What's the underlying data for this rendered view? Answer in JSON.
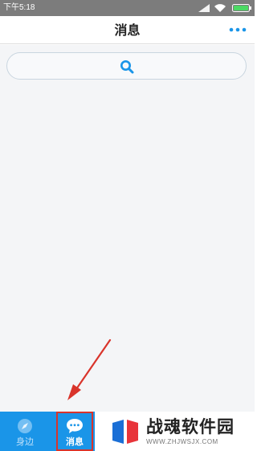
{
  "status_bar": {
    "time": "下午5:18",
    "icons": [
      "signal-icon",
      "wifi-icon",
      "battery-icon"
    ]
  },
  "header": {
    "title": "消息",
    "more_icon": "more-icon"
  },
  "search": {
    "icon": "search-icon",
    "placeholder": ""
  },
  "tab_bar": {
    "tabs": [
      {
        "label": "身边",
        "icon": "compass-icon",
        "selected": false
      },
      {
        "label": "消息",
        "icon": "chat-bubble-icon",
        "selected": true
      }
    ]
  },
  "watermark": {
    "title": "战魂软件园",
    "url": "WWW.ZHJWSJX.COM"
  },
  "colors": {
    "accent": "#1a95e8",
    "status_bar": "#7c7c7c",
    "annotation": "#d9342b",
    "battery": "#4cd964"
  }
}
